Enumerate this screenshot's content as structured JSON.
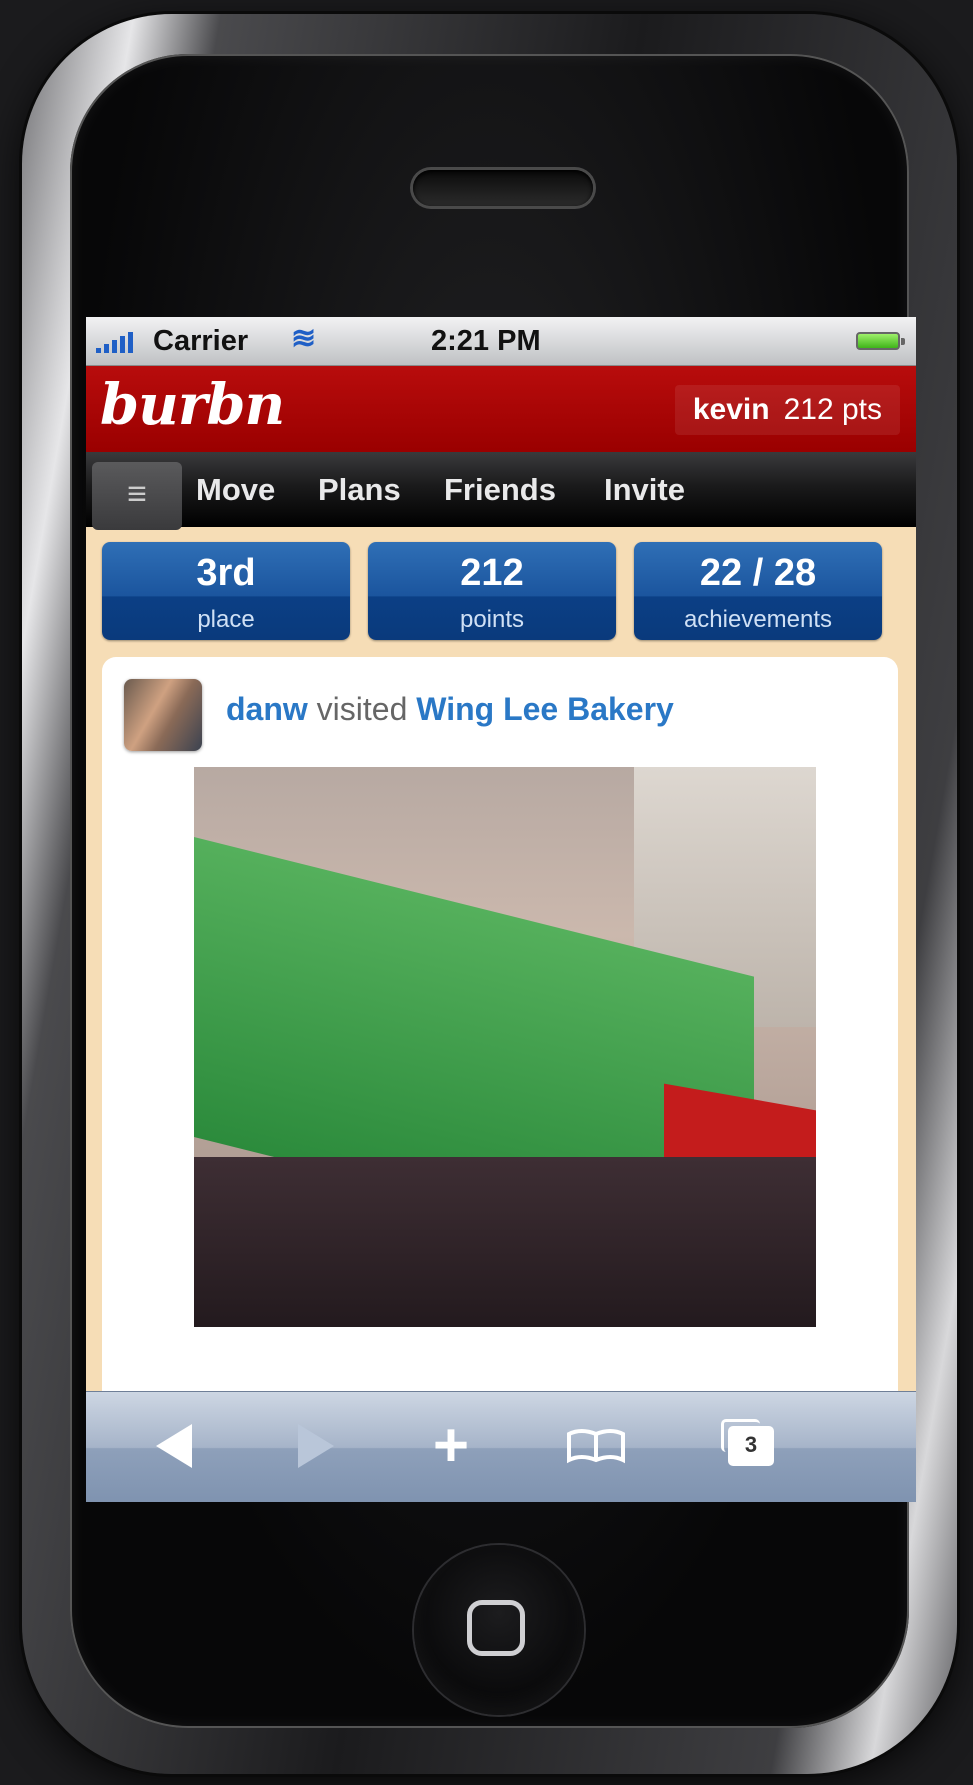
{
  "status_bar": {
    "carrier": "Carrier",
    "time": "2:21 PM"
  },
  "app": {
    "logo": "burbn",
    "user": {
      "name": "kevin",
      "points": "212 pts"
    }
  },
  "nav": {
    "menu_icon": "≡",
    "items": [
      {
        "label": "Move"
      },
      {
        "label": "Plans"
      },
      {
        "label": "Friends"
      },
      {
        "label": "Invite"
      }
    ]
  },
  "stats": [
    {
      "value": "3rd",
      "label": "place"
    },
    {
      "value": "212",
      "label": "points"
    },
    {
      "value": "22 / 28",
      "label": "achievements"
    }
  ],
  "feed": {
    "user": "danw",
    "verb": "visited",
    "place": "Wing Lee Bakery"
  },
  "safari": {
    "tabs_count": "3"
  },
  "colors": {
    "header_red": "#a80000",
    "nav_black": "#111111",
    "stat_blue": "#1b559e",
    "link_blue": "#2a78c6",
    "screen_bg": "#f6ddb6"
  },
  "icons": {
    "signal": "signal-bars-icon",
    "wifi": "wifi-icon",
    "battery": "battery-icon",
    "menu": "menu-icon",
    "back": "back-arrow-icon",
    "forward": "forward-arrow-icon",
    "add": "plus-icon",
    "bookmarks": "bookmarks-icon",
    "tabs": "tabs-icon"
  }
}
